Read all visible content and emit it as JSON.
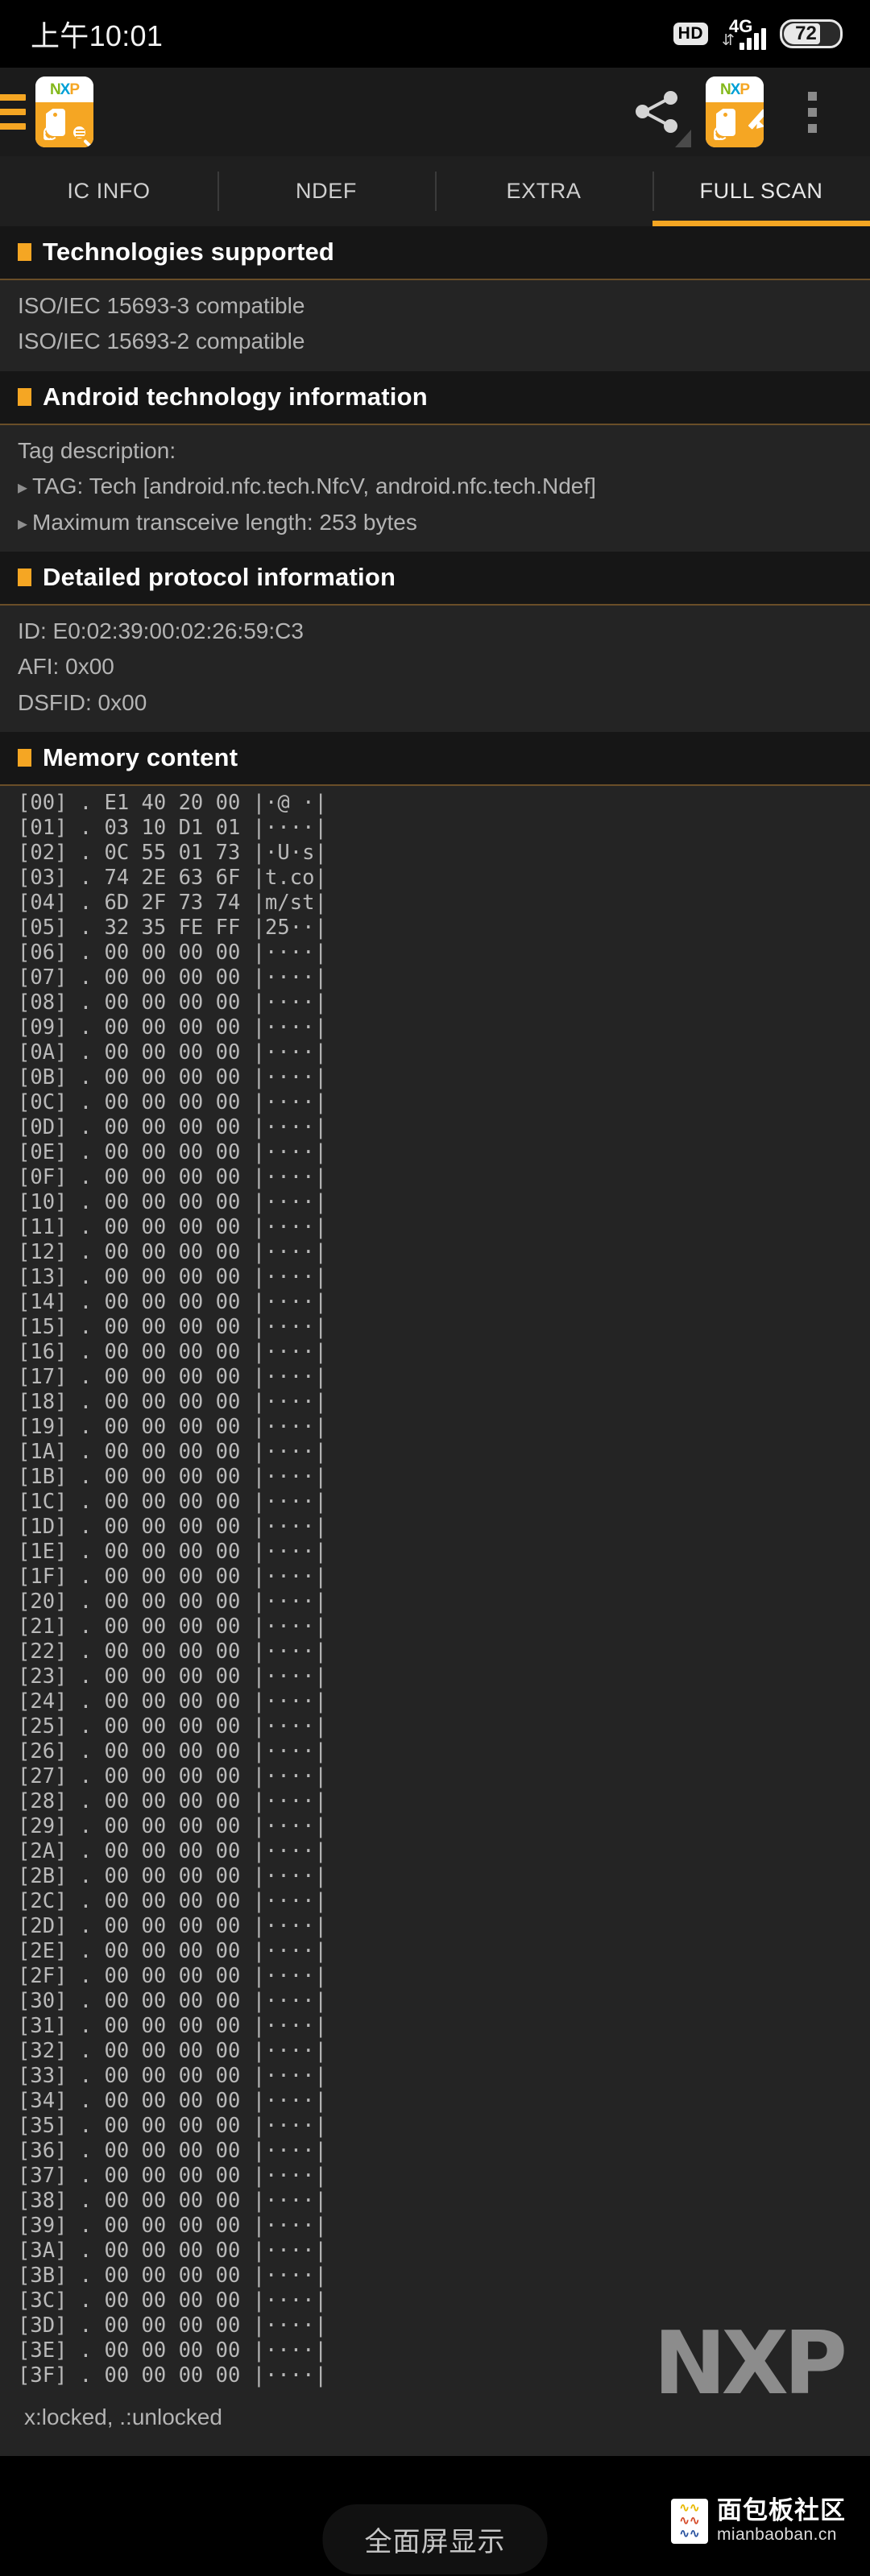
{
  "status_bar": {
    "clock": "上午10:01",
    "hd_label": "HD",
    "network_label": "4G",
    "battery_level": "72"
  },
  "app_bar": {
    "menu_icon": "hamburger-icon",
    "app_icon": "nxp-taginfo-icon",
    "share_icon": "share-icon",
    "tagwriter_icon": "nxp-tagwriter-icon",
    "overflow_icon": "overflow-menu-icon",
    "nxp_logo": {
      "n": "N",
      "x": "X",
      "p": "P"
    }
  },
  "tabs": [
    {
      "label": "IC INFO",
      "active": false
    },
    {
      "label": "NDEF",
      "active": false
    },
    {
      "label": "EXTRA",
      "active": false
    },
    {
      "label": "FULL SCAN",
      "active": true
    }
  ],
  "sections": {
    "technologies": {
      "title": "Technologies supported",
      "lines": [
        "ISO/IEC 15693-3 compatible",
        "ISO/IEC 15693-2 compatible"
      ]
    },
    "android_tech": {
      "title": "Android technology information",
      "label": "Tag description:",
      "items": [
        "TAG: Tech [android.nfc.tech.NfcV, android.nfc.tech.Ndef]",
        "Maximum transceive length: 253 bytes"
      ]
    },
    "protocol": {
      "title": "Detailed protocol information",
      "lines": [
        "ID: E0:02:39:00:02:26:59:C3",
        "AFI: 0x00",
        "DSFID: 0x00"
      ]
    },
    "memory": {
      "title": "Memory content",
      "legend": "x:locked, .:unlocked",
      "watermark": "NXP",
      "rows": [
        "[00] . E1 40 20 00 |·@ ·|",
        "[01] . 03 10 D1 01 |····|",
        "[02] . 0C 55 01 73 |·U·s|",
        "[03] . 74 2E 63 6F |t.co|",
        "[04] . 6D 2F 73 74 |m/st|",
        "[05] . 32 35 FE FF |25··|",
        "[06] . 00 00 00 00 |····|",
        "[07] . 00 00 00 00 |····|",
        "[08] . 00 00 00 00 |····|",
        "[09] . 00 00 00 00 |····|",
        "[0A] . 00 00 00 00 |····|",
        "[0B] . 00 00 00 00 |····|",
        "[0C] . 00 00 00 00 |····|",
        "[0D] . 00 00 00 00 |····|",
        "[0E] . 00 00 00 00 |····|",
        "[0F] . 00 00 00 00 |····|",
        "[10] . 00 00 00 00 |····|",
        "[11] . 00 00 00 00 |····|",
        "[12] . 00 00 00 00 |····|",
        "[13] . 00 00 00 00 |····|",
        "[14] . 00 00 00 00 |····|",
        "[15] . 00 00 00 00 |····|",
        "[16] . 00 00 00 00 |····|",
        "[17] . 00 00 00 00 |····|",
        "[18] . 00 00 00 00 |····|",
        "[19] . 00 00 00 00 |····|",
        "[1A] . 00 00 00 00 |····|",
        "[1B] . 00 00 00 00 |····|",
        "[1C] . 00 00 00 00 |····|",
        "[1D] . 00 00 00 00 |····|",
        "[1E] . 00 00 00 00 |····|",
        "[1F] . 00 00 00 00 |····|",
        "[20] . 00 00 00 00 |····|",
        "[21] . 00 00 00 00 |····|",
        "[22] . 00 00 00 00 |····|",
        "[23] . 00 00 00 00 |····|",
        "[24] . 00 00 00 00 |····|",
        "[25] . 00 00 00 00 |····|",
        "[26] . 00 00 00 00 |····|",
        "[27] . 00 00 00 00 |····|",
        "[28] . 00 00 00 00 |····|",
        "[29] . 00 00 00 00 |····|",
        "[2A] . 00 00 00 00 |····|",
        "[2B] . 00 00 00 00 |····|",
        "[2C] . 00 00 00 00 |····|",
        "[2D] . 00 00 00 00 |····|",
        "[2E] . 00 00 00 00 |····|",
        "[2F] . 00 00 00 00 |····|",
        "[30] . 00 00 00 00 |····|",
        "[31] . 00 00 00 00 |····|",
        "[32] . 00 00 00 00 |····|",
        "[33] . 00 00 00 00 |····|",
        "[34] . 00 00 00 00 |····|",
        "[35] . 00 00 00 00 |····|",
        "[36] . 00 00 00 00 |····|",
        "[37] . 00 00 00 00 |····|",
        "[38] . 00 00 00 00 |····|",
        "[39] . 00 00 00 00 |····|",
        "[3A] . 00 00 00 00 |····|",
        "[3B] . 00 00 00 00 |····|",
        "[3C] . 00 00 00 00 |····|",
        "[3D] . 00 00 00 00 |····|",
        "[3E] . 00 00 00 00 |····|",
        "[3F] . 00 00 00 00 |····|"
      ]
    }
  },
  "nav_bar": {
    "fullscreen_label": "全面屏显示",
    "watermark_title": "面包板社区",
    "watermark_url": "mianbaoban.cn"
  },
  "colors": {
    "accent": "#f5a623",
    "bg": "#242424",
    "header_bg": "#161616",
    "appbar_bg": "#1b1b1b"
  }
}
